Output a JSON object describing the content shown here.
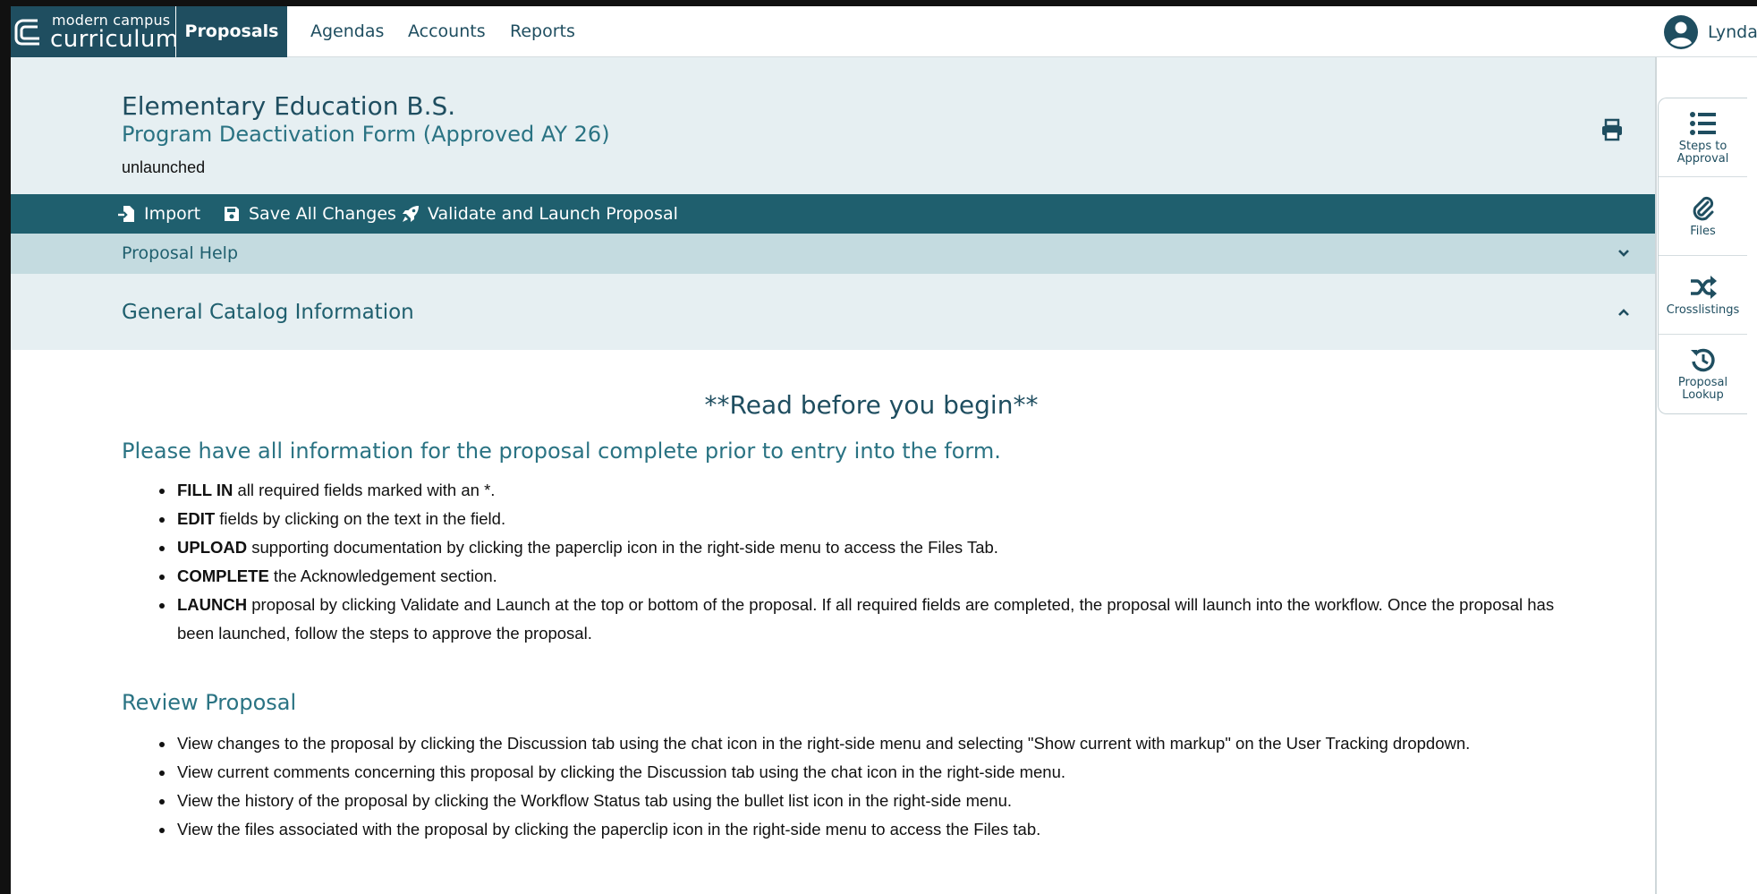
{
  "brand": {
    "line1": "modern campus",
    "line2": "curriculum",
    "tm": "™"
  },
  "nav": {
    "tabs": [
      "Proposals",
      "Agendas",
      "Accounts",
      "Reports"
    ],
    "active": "Proposals",
    "user_name": "Lyndal"
  },
  "header": {
    "program_title": "Elementary Education B.S.",
    "form_title": "Program Deactivation Form (Approved AY 26)",
    "status": "unlaunched"
  },
  "toolbar": {
    "import_label": "Import",
    "save_label": "Save All Changes",
    "launch_label": "Validate and Launch Proposal"
  },
  "help": {
    "label": "Proposal Help"
  },
  "section": {
    "label": "General Catalog Information"
  },
  "content": {
    "read_before": "**Read before you begin**",
    "intro_heading": "Please have all information for the proposal complete prior to entry into the form.",
    "instructions": [
      {
        "bold": "FILL IN",
        "text": " all required fields marked with an *."
      },
      {
        "bold": "EDIT",
        "text": " fields by clicking on the text in the field."
      },
      {
        "bold": "UPLOAD",
        "text": " supporting documentation by clicking the paperclip icon in the right-side menu to access the Files Tab."
      },
      {
        "bold": "COMPLETE",
        "text": " the Acknowledgement section."
      },
      {
        "bold": "LAUNCH",
        "text": " proposal by clicking Validate and Launch at the top or bottom of the proposal.  If all required fields are completed, the proposal will launch into the workflow. Once the proposal has been launched, follow the steps to approve the proposal."
      }
    ],
    "review_heading": "Review Proposal",
    "review_items": [
      "View changes to the proposal by clicking the Discussion tab using the chat icon in the right-side menu and selecting \"Show current with markup\" on the User Tracking dropdown.",
      "View current comments concerning this proposal by clicking the Discussion tab using the chat icon in the right-side menu.",
      "View the history of the proposal by clicking the Workflow Status tab using the bullet list icon in the right-side menu.",
      "View the files associated with the proposal by clicking the paperclip icon in the right-side menu to access the Files tab."
    ]
  },
  "rail": {
    "items": [
      {
        "label": "Steps to Approval",
        "icon": "list-icon"
      },
      {
        "label": "Files",
        "icon": "paperclip-icon"
      },
      {
        "label": "Crosslistings",
        "icon": "shuffle-icon"
      },
      {
        "label": "Proposal Lookup",
        "icon": "history-icon"
      }
    ]
  },
  "colors": {
    "brand": "#1f4e60",
    "toolbar": "#1f5f6e",
    "accent_text": "#2a7383",
    "band": "#e6eff2",
    "help_band": "#c4dbe0"
  }
}
